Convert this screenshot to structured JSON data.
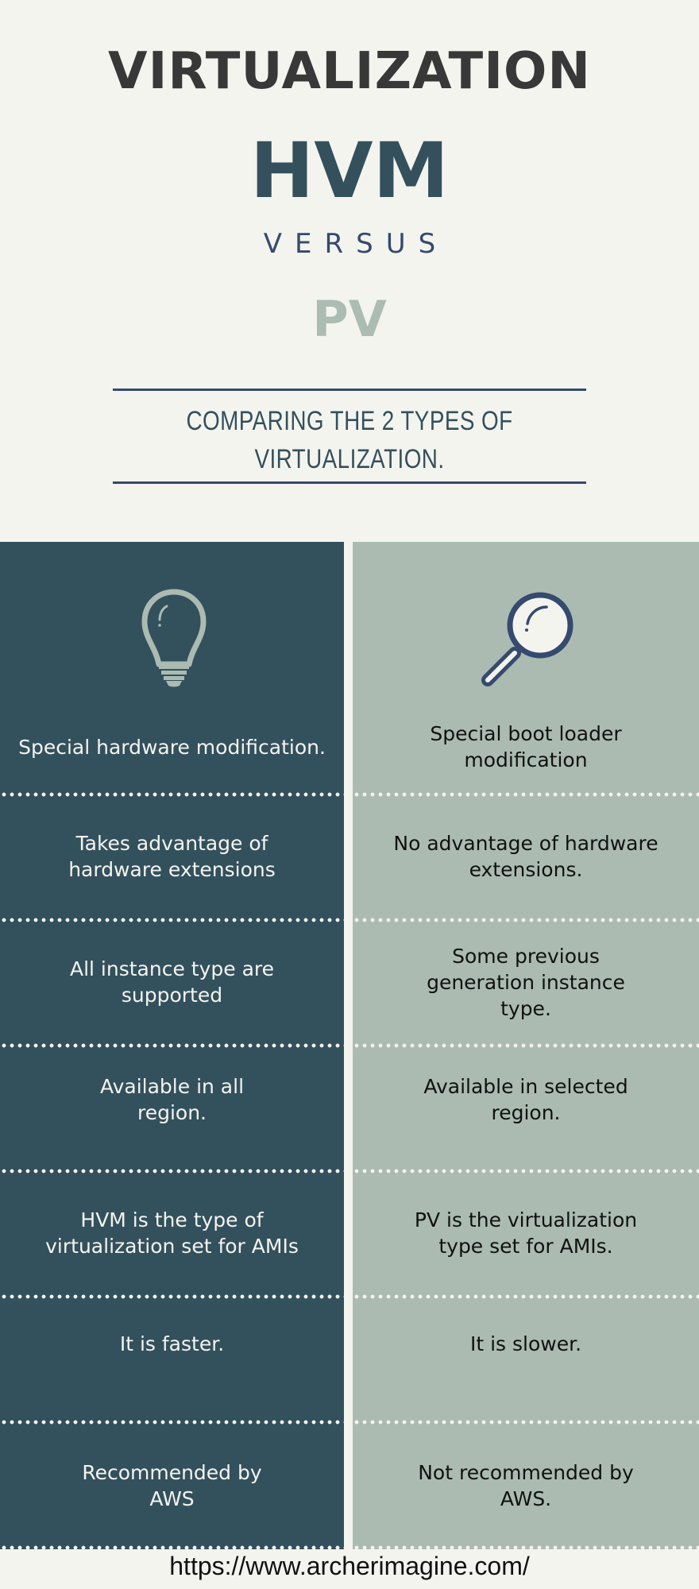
{
  "header": {
    "title": "VIRTUALIZATION",
    "left_name": "HVM",
    "versus": "VERSUS",
    "right_name": "PV",
    "subtitle_line1": "COMPARING THE 2 TYPES OF",
    "subtitle_line2": "VIRTUALIZATION."
  },
  "colors": {
    "background": "#f4f4ef",
    "hvm_column": "#33505d",
    "pv_column": "#abbbb1",
    "title_dark": "#383838",
    "accent_navy": "#354a6e",
    "pv_title": "#abbcb2"
  },
  "icons": {
    "hvm": "lightbulb-icon",
    "pv": "magnifying-glass-icon"
  },
  "comparison": {
    "rows": [
      {
        "hvm": "Special hardware modification.",
        "pv": "Special boot loader modification"
      },
      {
        "hvm": "Takes advantage of hardware extensions",
        "pv": "No advantage of hardware extensions."
      },
      {
        "hvm": "All instance type are supported",
        "pv": "Some previous generation instance type."
      },
      {
        "hvm": "Available in all region.",
        "pv": "Available in selected region."
      },
      {
        "hvm": "HVM is the type of virtualization set for AMIs",
        "pv": "PV is the virtualization type set for AMIs."
      },
      {
        "hvm": "It is faster.",
        "pv": "It is slower."
      },
      {
        "hvm": "Recommended by AWS",
        "pv": "Not recommended by AWS."
      }
    ]
  },
  "footer": {
    "url": "https://www.archerimagine.com/"
  }
}
